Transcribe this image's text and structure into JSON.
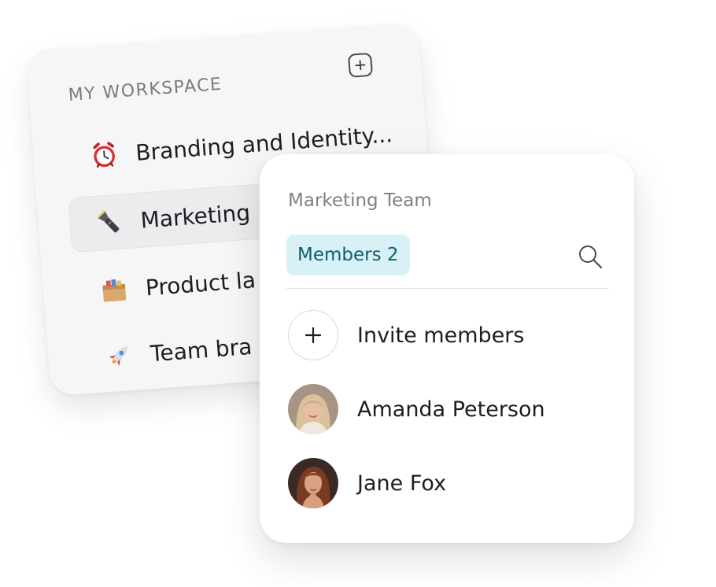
{
  "workspace": {
    "title": "MY WORKSPACE",
    "add_icon": "plus-square-icon",
    "items": [
      {
        "label": "Branding and Identity...",
        "icon": "alarm-clock-icon"
      },
      {
        "label": "Marketing",
        "icon": "flashlight-icon",
        "selected": true
      },
      {
        "label": "Product la",
        "icon": "box-icon"
      },
      {
        "label": "Team bra",
        "icon": "rocket-icon"
      }
    ]
  },
  "members_panel": {
    "team_name": "Marketing Team",
    "tab_label": "Members 2",
    "search_icon": "search-icon",
    "invite_label": "Invite members",
    "members": [
      {
        "name": "Amanda Peterson"
      },
      {
        "name": "Jane Fox"
      }
    ]
  },
  "colors": {
    "tab_background": "#d7f1f7",
    "tab_text": "#0f5e6e",
    "card_background": "#f6f6f7"
  }
}
